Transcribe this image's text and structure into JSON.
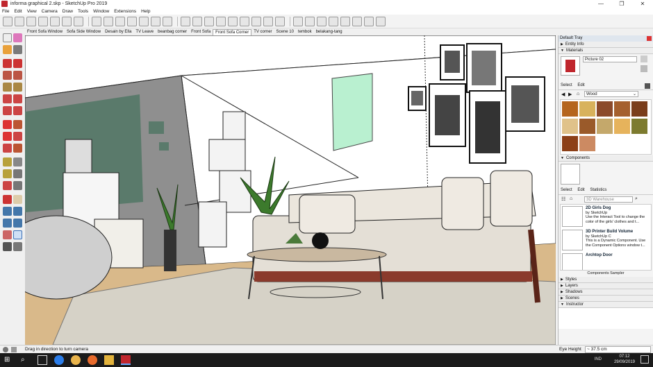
{
  "window": {
    "title": "informa graphical 2.skp - SketchUp Pro 2019",
    "minimize": "—",
    "maximize": "❐",
    "close": "✕"
  },
  "menu": [
    "File",
    "Edit",
    "View",
    "Camera",
    "Draw",
    "Tools",
    "Window",
    "Extensions",
    "Help"
  ],
  "scenes": [
    {
      "label": "Front Sofa Window",
      "active": false
    },
    {
      "label": "Sofa Side Window",
      "active": false
    },
    {
      "label": "Desain by Ella",
      "active": false
    },
    {
      "label": "TV Leave",
      "active": false
    },
    {
      "label": "beanbag corner",
      "active": false
    },
    {
      "label": "Front Sofa",
      "active": false
    },
    {
      "label": "Front Sofa Corner",
      "active": true
    },
    {
      "label": "TV corner",
      "active": false
    },
    {
      "label": "Scene 10",
      "active": false
    },
    {
      "label": "tembok",
      "active": false
    },
    {
      "label": "belakang-tang",
      "active": false
    }
  ],
  "tray": {
    "title": "Default Tray",
    "entity_info": "Entity Info",
    "materials": {
      "title": "Materials",
      "current_name": "Picture 02",
      "tab_select": "Select",
      "tab_edit": "Edit",
      "library": "Wood",
      "swatch_colors": [
        "#b5651d",
        "#d8b25c",
        "#8b4a2b",
        "#a5602e",
        "#7a3e1c",
        "#e0c28a",
        "#9a5a2a",
        "#c4a86b",
        "#e6b35c",
        "#7d7b2f",
        "#8c3f17",
        "#cc8a62"
      ]
    },
    "components": {
      "title": "Components",
      "tab_select": "Select",
      "tab_edit": "Edit",
      "tab_statistics": "Statistics",
      "search_placeholder": "3D Warehouse",
      "items": [
        {
          "name": "2D Girls Dog",
          "by": "by SketchUp",
          "desc": "Use the Interact Tool to change the color of the girls' clothes and t..."
        },
        {
          "name": "3D Printer Build Volume",
          "by": "by SketchUp C",
          "desc": "This is a Dynamic Component. Use the Component Options window t..."
        },
        {
          "name": "Archtop Door",
          "by": "",
          "desc": ""
        }
      ],
      "footer": "Components Sampler"
    },
    "collapsed": [
      "Styles",
      "Layers",
      "Shadows",
      "Scenes",
      "Instructor"
    ]
  },
  "status": {
    "hint": "Drag in direction to turn camera",
    "measure_label": "Eye Height",
    "measure_value": "~ 37.5 cm"
  },
  "taskbar": {
    "time": "07:12",
    "date": "29/09/2019",
    "lang": "IND"
  },
  "colors": {
    "wall_green": "#5a7a6b",
    "mint_panel": "#b9f0d0",
    "floor": "#d9b98a",
    "rug": "#d6d2c7",
    "sofa": "#e4dfd6",
    "accent_red": "#c0262d"
  }
}
